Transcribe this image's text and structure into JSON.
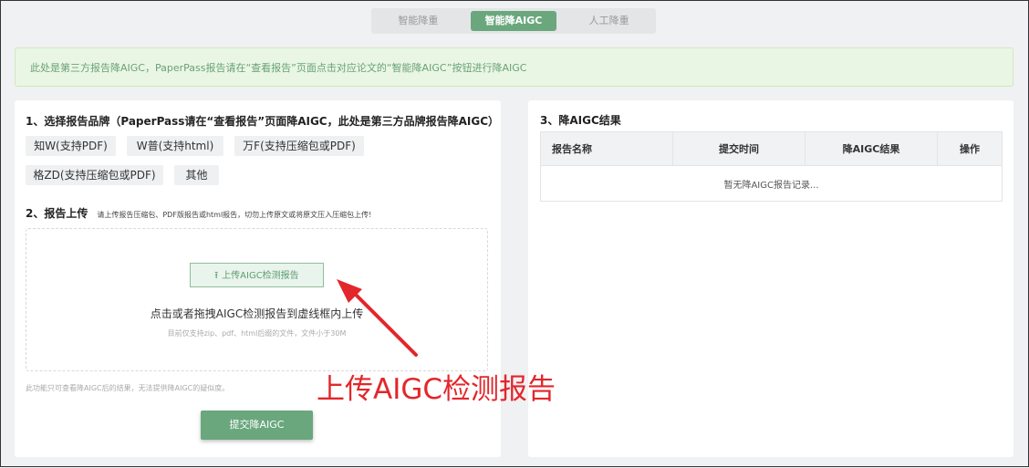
{
  "tabs": [
    {
      "label": "智能降重",
      "active": false
    },
    {
      "label": "智能降AIGC",
      "active": true
    },
    {
      "label": "人工降重",
      "active": false
    }
  ],
  "notice": "此处是第三方报告降AIGC，PaperPass报告请在“查看报告”页面点击对应论文的“智能降AIGC”按钮进行降AIGC",
  "section1": {
    "title": "1、选择报告品牌（PaperPass请在“查看报告”页面降AIGC，此处是第三方品牌报告降AIGC）",
    "brands": [
      "知W(支持PDF)",
      "W普(支持html)",
      "万F(支持压缩包或PDF)",
      "格ZD(支持压缩包或PDF)",
      "其他"
    ]
  },
  "section2": {
    "title": "2、报告上传",
    "hint": "请上传报告压缩包、PDF版报告或html报告，切勿上传原文或将原文压入压缩包上传!",
    "upload_icon": "upload-icon",
    "upload_label": "上传AIGC检测报告",
    "drop_text": "点击或者拖拽AIGC检测报告到虚线框内上传",
    "drop_sub": "目前仅支持zip、pdf、html后缀的文件，文件小于30M",
    "disclaimer": "此功能只可查看降AIGC后的结果，无法提供降AIGC的疑似度。",
    "submit_label": "提交降AIGC"
  },
  "section3": {
    "title": "3、降AIGC结果",
    "columns": [
      "报告名称",
      "提交时间",
      "降AIGC结果",
      "操作"
    ],
    "empty_text": "暂无降AIGC报告记录..."
  },
  "annotation": {
    "text": "上传AIGC检测报告",
    "color": "#e3262b"
  },
  "colors": {
    "accent": "#6aa77d",
    "notice_bg": "#eaf6e4",
    "notice_text": "#68a276"
  }
}
